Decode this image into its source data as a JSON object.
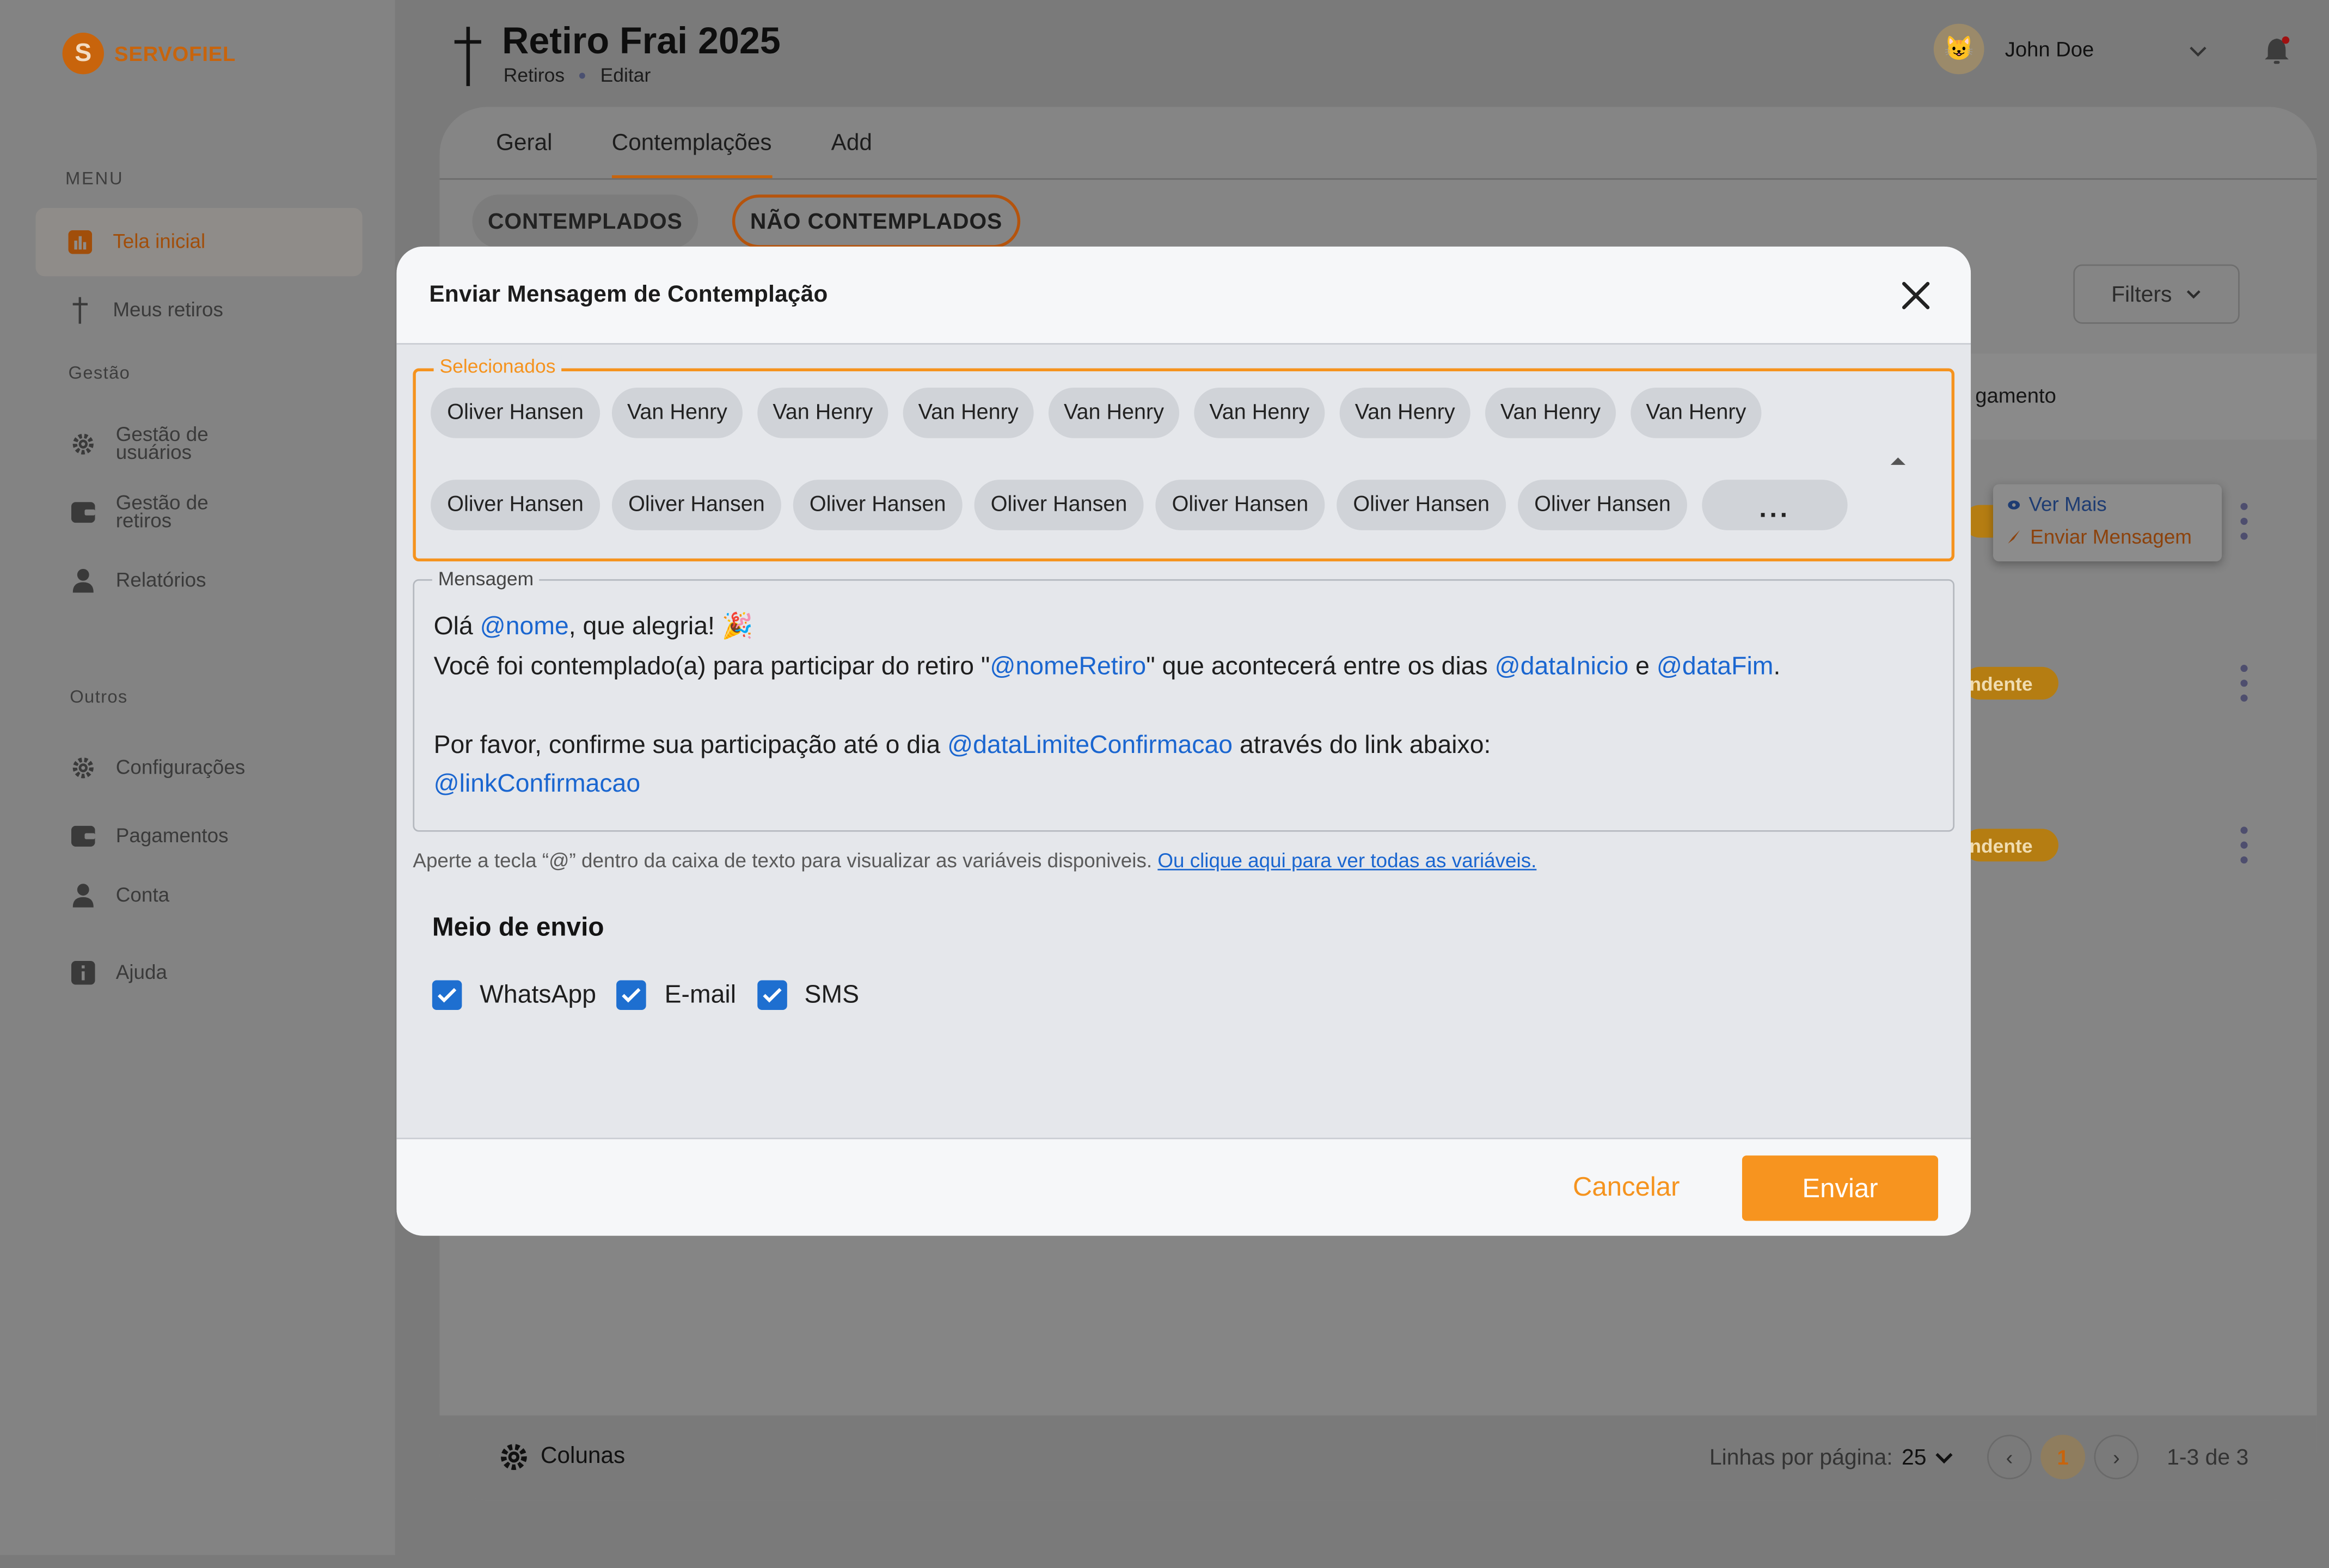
{
  "app": {
    "logo_letter": "S",
    "logo_text": "SERVOFIEL"
  },
  "sidebar": {
    "menu_label": "MENU",
    "gestao_label": "Gestão",
    "outros_label": "Outros",
    "items": [
      {
        "label": "Tela inicial"
      },
      {
        "label": "Meus retiros"
      },
      {
        "label": "Gestão de usuários"
      },
      {
        "label": "Gestão de retiros"
      },
      {
        "label": "Relatórios"
      },
      {
        "label": "Configurações"
      },
      {
        "label": "Pagamentos"
      },
      {
        "label": "Conta"
      },
      {
        "label": "Ajuda"
      }
    ]
  },
  "header": {
    "title": "Retiro Frai 2025",
    "breadcrumb": [
      "Retiros",
      "Editar"
    ],
    "user_name": "John Doe"
  },
  "page": {
    "tabs": [
      {
        "label": "Geral"
      },
      {
        "label": "Contemplações"
      },
      {
        "label": "Add"
      }
    ],
    "pill_contemplados": "CONTEMPLADOS",
    "pill_nao_contemplados": "NÃO CONTEMPLADOS",
    "filters_label": "Filters",
    "column_header_partial": "gamento",
    "status_partial": "ndente",
    "popover": {
      "ver_mais": "Ver Mais",
      "enviar_mensagem": "Enviar Mensagem"
    },
    "footer": {
      "columns_label": "Colunas",
      "rows_per_page_label": "Linhas por página:",
      "rows_per_page_value": "25",
      "current_page": "1",
      "range": "1-3 de 3"
    }
  },
  "modal": {
    "title": "Enviar Mensagem de Contemplação",
    "selected_legend": "Selecionados",
    "selected_chips_row1": [
      "Oliver Hansen",
      "Van Henry",
      "Van Henry",
      "Van Henry",
      "Van Henry",
      "Van Henry",
      "Van Henry",
      "Van Henry",
      "Van Henry"
    ],
    "selected_chips_row2": [
      "Oliver Hansen",
      "Oliver Hansen",
      "Oliver Hansen",
      "Oliver Hansen",
      "Oliver Hansen",
      "Oliver Hansen",
      "Oliver Hansen"
    ],
    "more_chip": "...",
    "message_legend": "Mensagem",
    "message": {
      "l1_a": "Olá ",
      "l1_var": "@nome",
      "l1_b": ", que alegria! 🎉",
      "l2_a": "Você foi contemplado(a) para participar do retiro \"",
      "l2_var1": "@nomeRetiro",
      "l2_b": "\" que acontecerá entre os dias ",
      "l2_var2": "@dataInicio",
      "l2_c": " e ",
      "l2_var3": "@dataFim",
      "l2_d": ".",
      "l3_a": "Por favor, confirme sua participação até o dia ",
      "l3_var": "@dataLimiteConfirmacao",
      "l3_b": " através do link abaixo:",
      "l4_var": "@linkConfirmacao"
    },
    "hint_text": "Aperte a tecla “@” dentro da caixa de texto para visualizar as variáveis disponiveis. ",
    "hint_link": "Ou clique aqui para ver todas as variáveis.",
    "send_method_title": "Meio de envio",
    "channels": [
      {
        "label": "WhatsApp",
        "checked": true
      },
      {
        "label": "E-mail",
        "checked": true
      },
      {
        "label": "SMS",
        "checked": true
      }
    ],
    "cancel_label": "Cancelar",
    "send_label": "Enviar"
  },
  "colors": {
    "accent": "#f7941f",
    "link": "#1a66d0",
    "checkbox": "#1e6fd0"
  }
}
